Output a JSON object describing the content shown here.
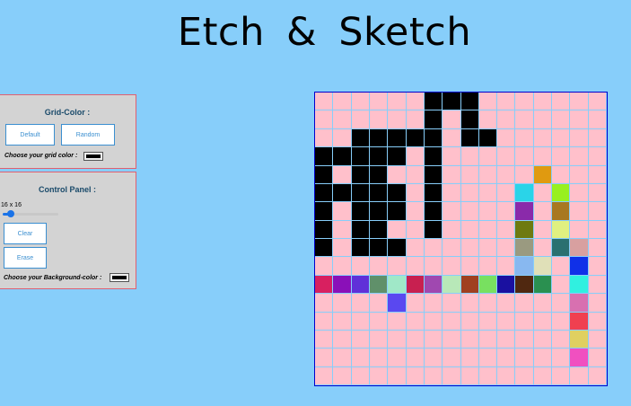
{
  "title": "Etch & Sketch",
  "grid_color_panel": {
    "heading": "Grid-Color :",
    "default_label": "Default",
    "random_label": "Random",
    "color_prompt": "Choose your grid color :",
    "color_value": "#000000"
  },
  "control_panel": {
    "heading": "Control Panel :",
    "size_label": "16 x 16",
    "size_value": 16,
    "size_min": 2,
    "size_max": 100,
    "clear_label": "Clear",
    "erase_label": "Erase",
    "bg_prompt": "Choose your Background-color :",
    "bg_value": "#000000"
  },
  "grid": {
    "size": 16,
    "background": "#ffc0cb",
    "line_color": "#87cefa",
    "cells": [
      [
        null,
        null,
        null,
        null,
        null,
        null,
        "#000",
        "#000",
        "#000",
        null,
        null,
        null,
        null,
        null,
        null,
        null
      ],
      [
        null,
        null,
        null,
        null,
        null,
        null,
        "#000",
        null,
        "#000",
        null,
        null,
        null,
        null,
        null,
        null,
        null
      ],
      [
        null,
        null,
        "#000",
        "#000",
        "#000",
        "#000",
        "#000",
        null,
        "#000",
        "#000",
        null,
        null,
        null,
        null,
        null,
        null
      ],
      [
        "#000",
        "#000",
        "#000",
        "#000",
        "#000",
        null,
        "#000",
        null,
        null,
        null,
        null,
        null,
        null,
        null,
        null,
        null
      ],
      [
        "#000",
        null,
        "#000",
        "#000",
        null,
        null,
        "#000",
        null,
        null,
        null,
        null,
        null,
        "#e09a10",
        null,
        null,
        null
      ],
      [
        "#000",
        "#000",
        "#000",
        "#000",
        "#000",
        null,
        "#000",
        null,
        null,
        null,
        null,
        "#2ad4e8",
        null,
        "#98f020",
        null,
        null
      ],
      [
        "#000",
        null,
        "#000",
        "#000",
        "#000",
        null,
        "#000",
        null,
        null,
        null,
        null,
        "#8a2aaa",
        null,
        "#a87820",
        null,
        null
      ],
      [
        "#000",
        null,
        "#000",
        "#000",
        null,
        null,
        "#000",
        null,
        null,
        null,
        null,
        "#6e7a10",
        null,
        "#e0f080",
        null,
        null
      ],
      [
        "#000",
        null,
        "#000",
        "#000",
        "#000",
        null,
        null,
        null,
        null,
        null,
        null,
        "#9a9a80",
        null,
        "#2a7070",
        "#d8a0a0",
        null
      ],
      [
        null,
        null,
        null,
        null,
        null,
        null,
        null,
        null,
        null,
        null,
        null,
        "#88b8f0",
        "#e0e0b8",
        null,
        "#1030e8",
        null
      ],
      [
        "#d82060",
        "#8a10b8",
        "#6030d8",
        "#60906a",
        "#a0e8c8",
        "#c82050",
        "#a048b0",
        "#b8e8b8",
        "#a04020",
        "#78e060",
        "#1a10a0",
        "#502810",
        "#2a9050",
        null,
        "#30f0e0",
        null
      ],
      [
        null,
        null,
        null,
        null,
        "#5a48f0",
        null,
        null,
        null,
        null,
        null,
        null,
        null,
        null,
        null,
        "#d870b0",
        null
      ],
      [
        null,
        null,
        null,
        null,
        null,
        null,
        null,
        null,
        null,
        null,
        null,
        null,
        null,
        null,
        "#f04050",
        null
      ],
      [
        null,
        null,
        null,
        null,
        null,
        null,
        null,
        null,
        null,
        null,
        null,
        null,
        null,
        null,
        "#e0d060",
        null
      ],
      [
        null,
        null,
        null,
        null,
        null,
        null,
        null,
        null,
        null,
        null,
        null,
        null,
        null,
        null,
        "#f050c0",
        null
      ],
      [
        null,
        null,
        null,
        null,
        null,
        null,
        null,
        null,
        null,
        null,
        null,
        null,
        null,
        null,
        null,
        null
      ]
    ]
  }
}
